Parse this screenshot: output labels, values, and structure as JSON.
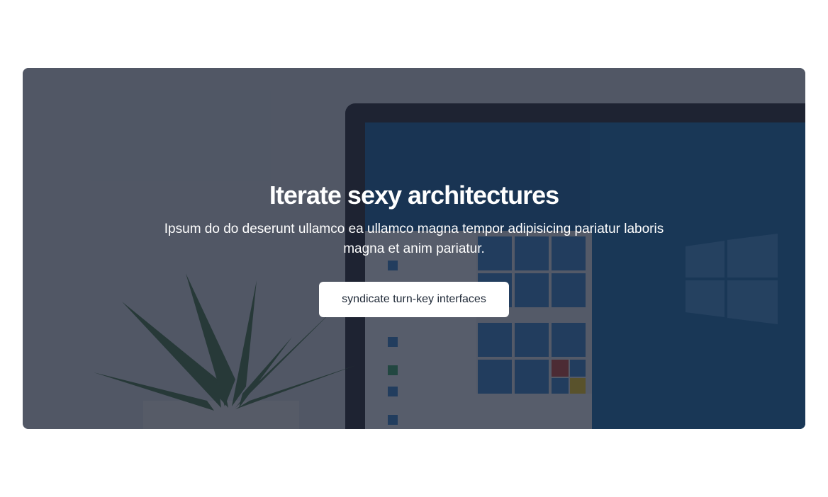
{
  "hero": {
    "title": "Iterate sexy architectures",
    "subtitle": "Ipsum do do deserunt ullamco ea ullamco magna tempor adipisicing pariatur laboris magna et anim pariatur.",
    "cta_label": "syndicate turn-key interfaces"
  },
  "colors": {
    "overlay": "#1e2637",
    "screen": "#0d4f8a",
    "button_bg": "#ffffff",
    "button_text": "#1f2937"
  }
}
